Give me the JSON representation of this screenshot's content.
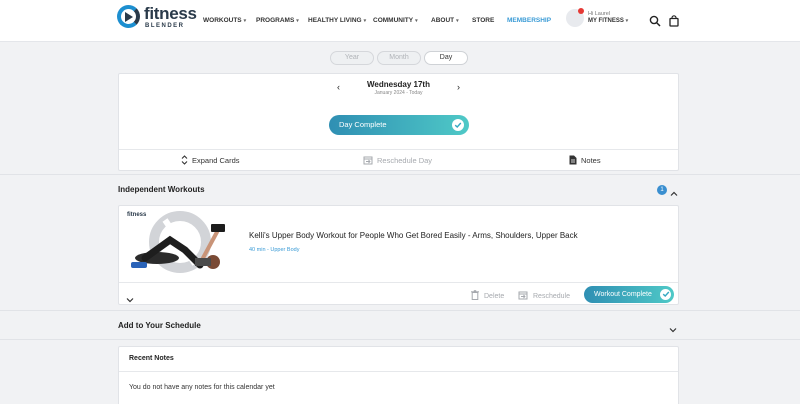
{
  "brand": {
    "name": "fitness",
    "sub": "BLENDER",
    "color": "#1d8fd0"
  },
  "nav": [
    {
      "label": "WORKOUTS",
      "caret": "▾"
    },
    {
      "label": "PROGRAMS",
      "caret": "▾"
    },
    {
      "label": "HEALTHY LIVING",
      "caret": "▾"
    },
    {
      "label": "COMMUNITY",
      "caret": "▾"
    },
    {
      "label": "ABOUT",
      "caret": "▾"
    },
    {
      "label": "STORE",
      "caret": ""
    },
    {
      "label": "MEMBERSHIP",
      "caret": ""
    }
  ],
  "user": {
    "greeting": "Hi Laurel",
    "menu": "MY FITNESS",
    "caret": "▾",
    "notification_color": "#e53935"
  },
  "header_icons": [
    "search-icon",
    "shopping-bag-icon"
  ],
  "view_tabs": {
    "year": "Year",
    "month": "Month",
    "day": "Day",
    "selected": "Day"
  },
  "day": {
    "title": "Wednesday 17th",
    "subtitle": "January 2024 - Today",
    "prev": "‹",
    "next": "›",
    "complete_label": "Day Complete"
  },
  "day_actions": {
    "expand": "Expand Cards",
    "reschedule": "Reschedule Day",
    "notes": "Notes"
  },
  "independent": {
    "title": "Independent Workouts",
    "count": "1"
  },
  "workout": {
    "brand_tag": "fitness",
    "title": "Kelli's Upper Body Workout for People Who Get Bored Easily - Arms, Shoulders, Upper Back",
    "meta": "40 min - Upper Body",
    "delete": "Delete",
    "reschedule": "Reschedule",
    "complete": "Workout Complete"
  },
  "schedule": {
    "title": "Add to Your Schedule"
  },
  "notes": {
    "title": "Recent Notes",
    "empty": "You do not have any notes for this calendar yet"
  },
  "colors": {
    "accent": "#3a9bd6",
    "gradient_start": "#2f8fb3",
    "gradient_end": "#4fc9c7"
  }
}
